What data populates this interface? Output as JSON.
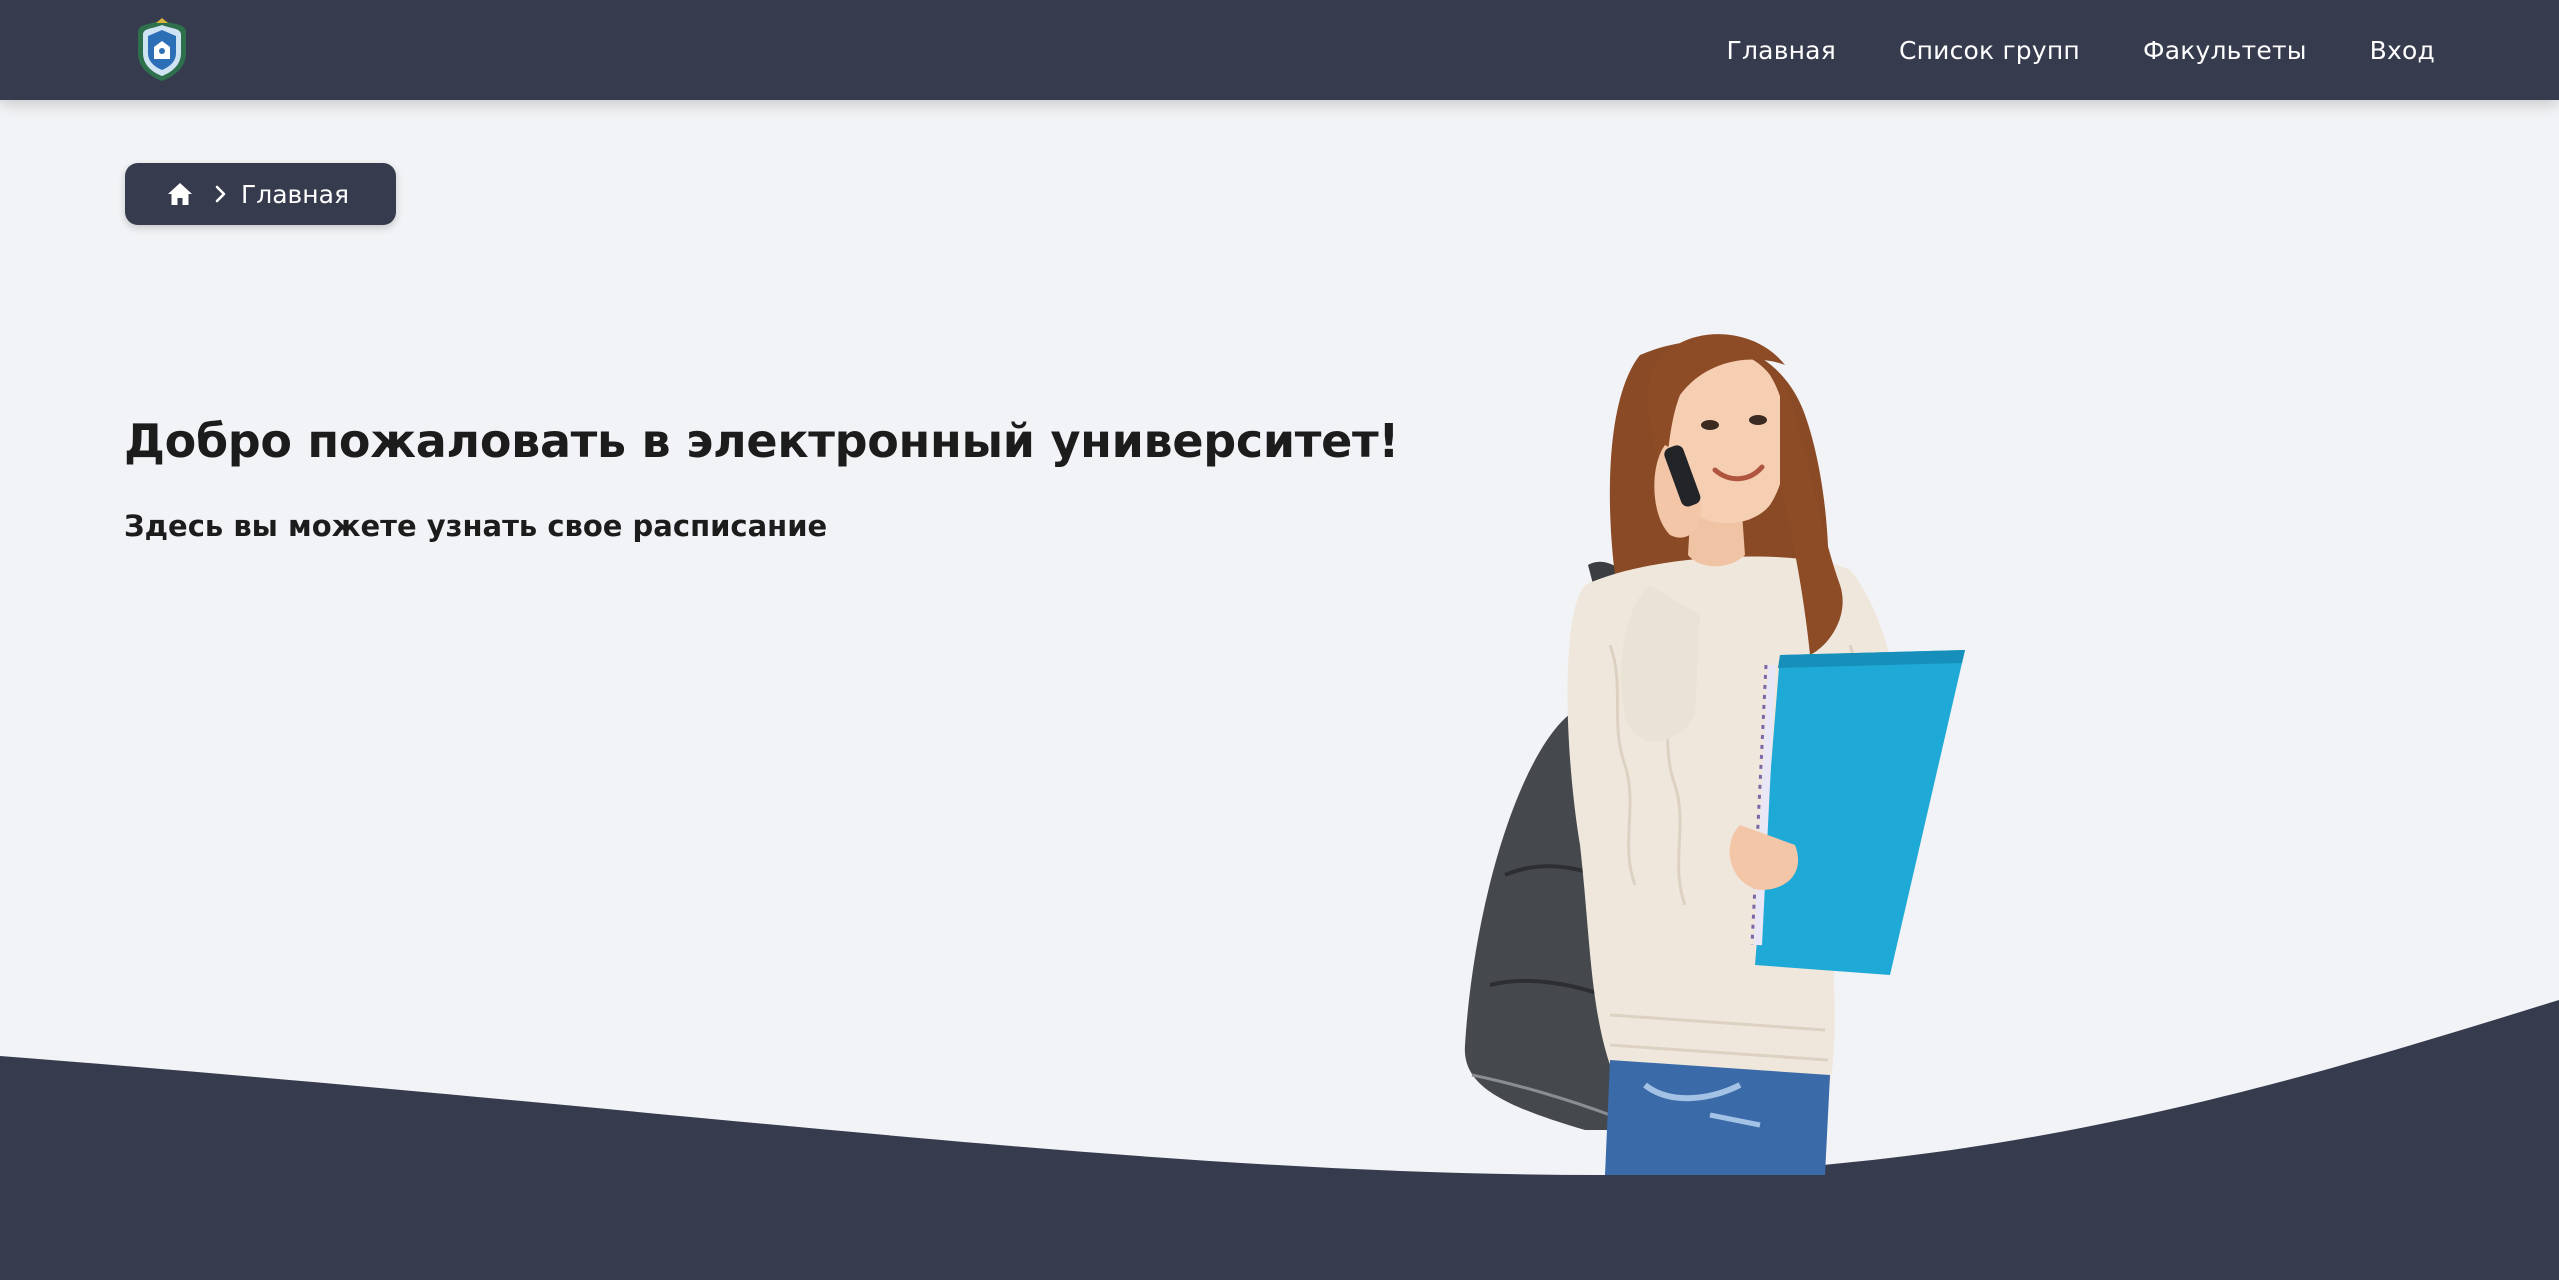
{
  "header": {
    "logo_icon": "university-crest-icon",
    "nav": [
      {
        "label": "Главная"
      },
      {
        "label": "Список групп"
      },
      {
        "label": "Факультеты"
      },
      {
        "label": "Вход"
      }
    ]
  },
  "breadcrumb": {
    "home_icon": "home-icon",
    "separator_icon": "chevron-right-icon",
    "current": "Главная"
  },
  "hero": {
    "title": "Добро пожаловать в электронный университет!",
    "subtitle": "Здесь вы можете узнать свое расписание",
    "image": "student-with-phone-illustration"
  },
  "colors": {
    "primary": "#373b4e",
    "background": "#f2f3f6",
    "accent_folder": "#1fa9d6",
    "text": "#1c1c1c"
  }
}
